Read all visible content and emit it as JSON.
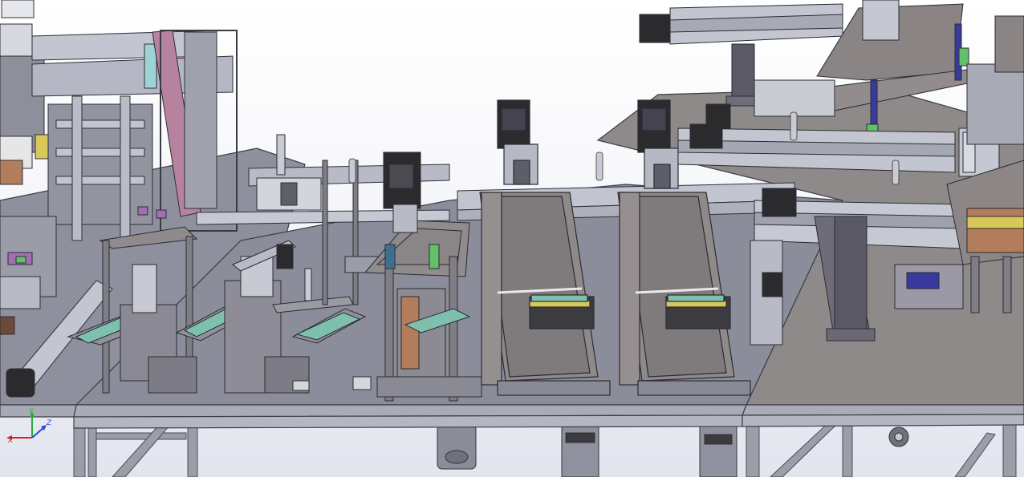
{
  "scene": {
    "colors": {
      "table_top": "#8e8f9c",
      "table_frame": "#9a9ca8",
      "steel": "#a9abb8",
      "rail": "#c6c9d4",
      "pcb": "#7fbfae",
      "motor": "#2b2b2e",
      "column": "#4f4d5a",
      "press_plate": "#858080",
      "magenta": "#b7829e",
      "cyan": "#9ed3d6",
      "copper": "#b27d5a",
      "yellow": "#d8c85a"
    },
    "stations": [
      "loader-gantry",
      "pcb-station-1",
      "pcb-station-2",
      "pcb-station-3",
      "press-station",
      "vertical-press-1",
      "vertical-press-2",
      "upper-gantry",
      "right-module"
    ]
  },
  "triad": {
    "x_label": "X",
    "y_label": "Y",
    "z_label": "Z",
    "x_color": "#d0252a",
    "y_color": "#2cab3a",
    "z_color": "#2a4ad0"
  }
}
